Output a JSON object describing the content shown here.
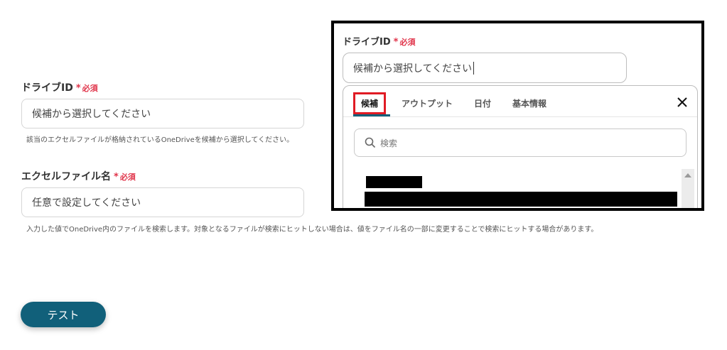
{
  "form": {
    "drive_id": {
      "label": "ドライブID",
      "required_mark": "*",
      "required_text": "必須",
      "placeholder": "候補から選択してください",
      "help": "該当のエクセルファイルが格納されているOneDriveを候補から選択してください。"
    },
    "file_name": {
      "label": "エクセルファイル名",
      "required_mark": "*",
      "required_text": "必須",
      "placeholder": "任意で設定してください",
      "help": "入力した値でOneDrive内のファイルを検索します。対象となるファイルが検索にヒットしない場合は、値をファイル名の一部に変更することで検索にヒットする場合があります。"
    },
    "test_button": "テスト"
  },
  "zoom_panel": {
    "label": "ドライブID",
    "required_mark": "*",
    "required_text": "必須",
    "input_value": "候補から選択してください",
    "tabs": [
      "候補",
      "アウトプット",
      "日付",
      "基本情報"
    ],
    "active_tab": "候補",
    "search_placeholder": "検索"
  },
  "colors": {
    "accent": "#11607a",
    "required": "#e0344a",
    "highlight": "#e01b24"
  }
}
